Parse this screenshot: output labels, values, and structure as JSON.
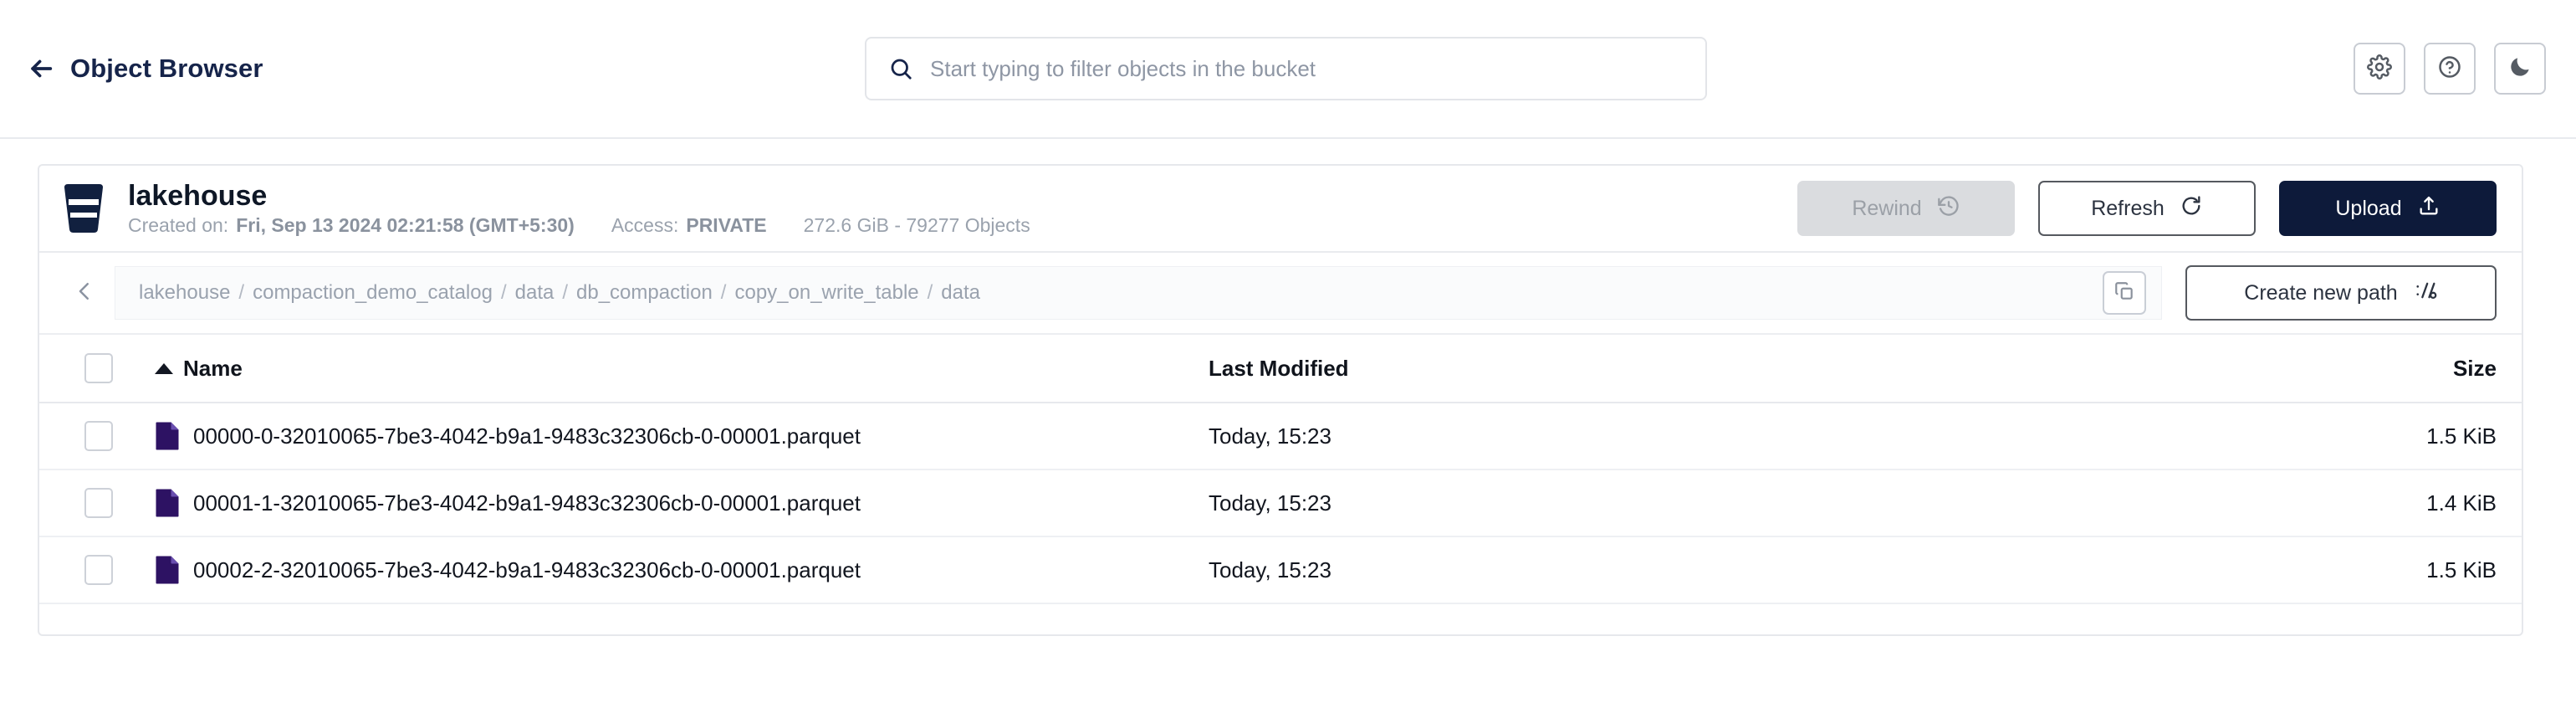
{
  "topbar": {
    "back_label": "Object Browser",
    "back_icon": "arrow-left-icon",
    "search": {
      "placeholder": "Start typing to filter objects in the bucket",
      "value": "",
      "icon": "search-icon"
    },
    "actions": [
      {
        "name": "settings-button",
        "icon": "gear-icon"
      },
      {
        "name": "help-button",
        "icon": "question-circle-icon"
      },
      {
        "name": "dark-mode-button",
        "icon": "moon-icon"
      }
    ]
  },
  "bucket": {
    "icon": "bucket-icon",
    "name": "lakehouse",
    "created_label": "Created on:",
    "created_value": "Fri, Sep 13 2024 02:21:58 (GMT+5:30)",
    "access_label": "Access:",
    "access_value": "PRIVATE",
    "usage": "272.6 GiB - 79277 Objects",
    "actions": {
      "rewind_label": "Rewind",
      "rewind_icon": "rewind-clock-icon",
      "rewind_disabled": true,
      "refresh_label": "Refresh",
      "refresh_icon": "refresh-icon",
      "upload_label": "Upload",
      "upload_icon": "upload-icon"
    }
  },
  "breadcrumb": {
    "back_icon": "chevron-left-icon",
    "segments": [
      "lakehouse",
      "compaction_demo_catalog",
      "data",
      "db_compaction",
      "copy_on_write_table",
      "data"
    ],
    "separator": "/",
    "copy_icon": "copy-icon",
    "create_path_label": "Create new path",
    "create_path_icon": "path-slash-icon"
  },
  "table": {
    "columns": {
      "name": "Name",
      "last_modified": "Last Modified",
      "size": "Size"
    },
    "sort": {
      "column": "Name",
      "direction": "asc"
    },
    "rows": [
      {
        "icon": "parquet-file-icon",
        "name": "00000-0-32010065-7be3-4042-b9a1-9483c32306cb-0-00001.parquet",
        "last_modified": "Today, 15:23",
        "size": "1.5 KiB",
        "selected": false
      },
      {
        "icon": "parquet-file-icon",
        "name": "00001-1-32010065-7be3-4042-b9a1-9483c32306cb-0-00001.parquet",
        "last_modified": "Today, 15:23",
        "size": "1.4 KiB",
        "selected": false
      },
      {
        "icon": "parquet-file-icon",
        "name": "00002-2-32010065-7be3-4042-b9a1-9483c32306cb-0-00001.parquet",
        "last_modified": "Today, 15:23",
        "size": "1.5 KiB",
        "selected": false
      }
    ]
  },
  "colors": {
    "brand_navy": "#0d1a3a",
    "file_icon": "#2d1263",
    "muted_text": "#9aa2ae",
    "border": "#e6e8ec"
  }
}
